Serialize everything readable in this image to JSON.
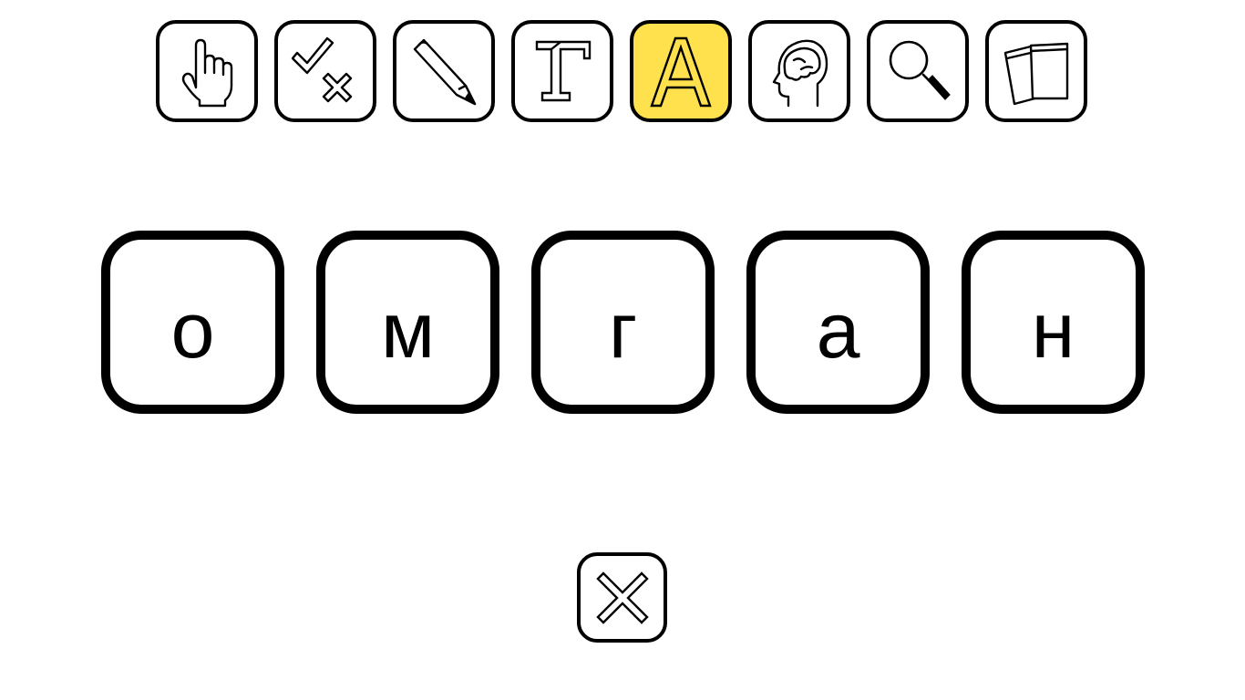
{
  "toolbar": {
    "tools": [
      {
        "id": "pointer",
        "icon": "hand-pointer-icon",
        "active": false
      },
      {
        "id": "check",
        "icon": "check-cross-icon",
        "active": false
      },
      {
        "id": "pencil",
        "icon": "pencil-icon",
        "active": false
      },
      {
        "id": "font",
        "icon": "cyrillic-ge-letter-icon",
        "active": false
      },
      {
        "id": "alphabet",
        "icon": "letter-a-icon",
        "active": true
      },
      {
        "id": "head",
        "icon": "head-brain-icon",
        "active": false
      },
      {
        "id": "search",
        "icon": "magnifier-icon",
        "active": false
      },
      {
        "id": "cards",
        "icon": "cards-icon",
        "active": false
      }
    ],
    "active_color": "#ffe14d"
  },
  "tiles": [
    {
      "letter": "о"
    },
    {
      "letter": "м"
    },
    {
      "letter": "г"
    },
    {
      "letter": "а"
    },
    {
      "letter": "н"
    }
  ],
  "close": {
    "icon": "close-x-icon"
  }
}
